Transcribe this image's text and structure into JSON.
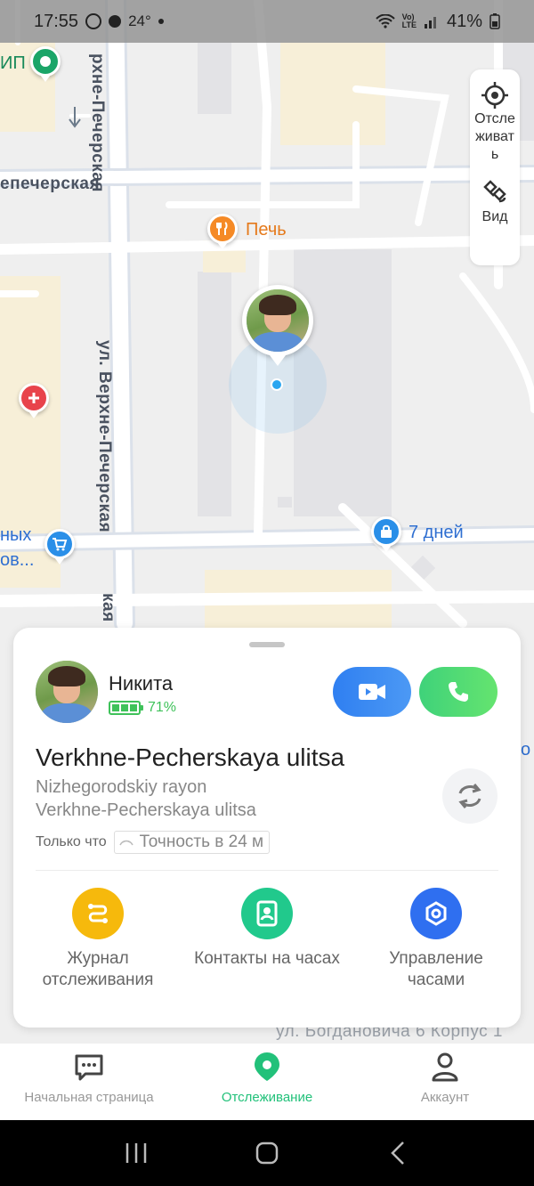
{
  "status_bar": {
    "time": "17:55",
    "temperature": "24°",
    "battery_percent": "41%",
    "icons": [
      "whatsapp-icon",
      "weather-icon",
      "wifi-icon",
      "volte-icon",
      "signal-icon",
      "battery-icon"
    ]
  },
  "map": {
    "street_labels": {
      "top_vertical": "рхне-Печерская",
      "left_horizontal": "епечерская",
      "main_vertical": "ул. Верхне-Печерская",
      "bottom_vertical": "кая",
      "bottom_right": "ул. Богдановича 6 Корпус 1"
    },
    "pois": {
      "top_left": "ИП",
      "restaurant": "Печь",
      "shop_line1": "ных",
      "shop_line2": "ов...",
      "shop_right": "7 дней",
      "edge_right": "о"
    },
    "controls": {
      "track_label": "Отслеживать",
      "view_label": "Вид"
    }
  },
  "card": {
    "name": "Никита",
    "battery": "71%",
    "battery_level": 0.71,
    "address_title": "Verkhne-Pecherskaya ulitsa",
    "address_line1": "Nizhegorodskiy rayon",
    "address_line2": "Verkhne-Pecherskaya ulitsa",
    "updated": "Только что",
    "accuracy": "Точность в 24 м",
    "actions": [
      {
        "label": "Журнал отслеживания",
        "icon": "route-icon",
        "color": "#f6b90c"
      },
      {
        "label": "Контакты на часах",
        "icon": "contacts-icon",
        "color": "#21c98c"
      },
      {
        "label": "Управление часами",
        "icon": "settings-icon",
        "color": "#2f6ff0"
      }
    ]
  },
  "bottom_nav": [
    {
      "label": "Начальная страница",
      "icon": "chat-icon",
      "active": false
    },
    {
      "label": "Отслеживание",
      "icon": "location-pin-icon",
      "active": true
    },
    {
      "label": "Аккаунт",
      "icon": "person-icon",
      "active": false
    }
  ],
  "colors": {
    "accent_green": "#22c17a",
    "video_blue": "#2f7ff1",
    "call_green": "#3fd27a"
  }
}
